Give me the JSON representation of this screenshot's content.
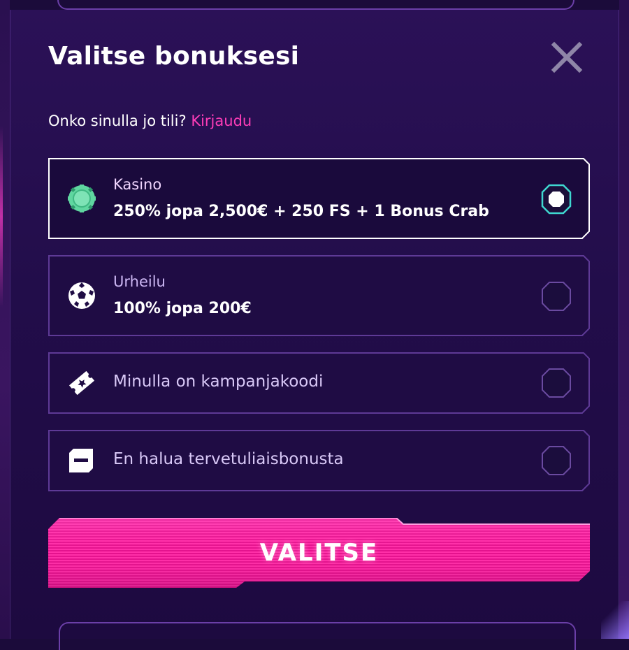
{
  "modal": {
    "title": "Valitse bonuksesi",
    "close_icon": "close-icon",
    "account_prompt": "Onko sinulla jo tili?",
    "login_link": "Kirjaudu"
  },
  "options": [
    {
      "id": "casino",
      "icon": "casino-chip-icon",
      "label": "Kasino",
      "value": "250% jopa 2,500€ + 250 FS + 1 Bonus Crab",
      "selected": true
    },
    {
      "id": "sports",
      "icon": "soccer-ball-icon",
      "label": "Urheilu",
      "value": "100% jopa 200€",
      "selected": false
    },
    {
      "id": "promo",
      "icon": "ticket-icon",
      "label": "Minulla on kampanjakoodi",
      "selected": false
    },
    {
      "id": "none",
      "icon": "no-bonus-icon",
      "label": "En halua tervetuliaisbonusta",
      "selected": false
    }
  ],
  "cta": {
    "label": "VALITSE"
  },
  "colors": {
    "accent_pink": "#ff3db8",
    "chip_green": "#5fd6a0",
    "radio_selected_ring": "#3fd8d0",
    "border_purple": "#6b3fa8"
  }
}
